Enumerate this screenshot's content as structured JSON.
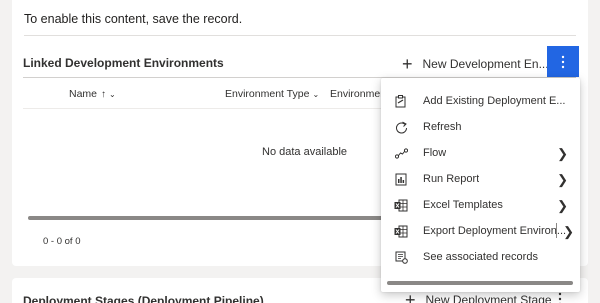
{
  "notice": {
    "text": "To enable this content, save the record."
  },
  "linked_subgrid": {
    "title": "Linked Development Environments",
    "new_button_label": "New Development En...",
    "more_commands_icon": "more-vertical-icon",
    "columns": [
      {
        "label": "Name",
        "sort": "ascending"
      },
      {
        "label": "Environment Type"
      },
      {
        "label": "Environment"
      }
    ],
    "empty_message": "No data available",
    "paging": "0 - 0 of 0"
  },
  "stages_subgrid": {
    "title": "Deployment Stages (Deployment Pipeline)",
    "new_button_label": "New Deployment Stage"
  },
  "overflow_menu": {
    "items": [
      {
        "label": "Add Existing Deployment E...",
        "icon": "add-existing-icon",
        "has_submenu": false
      },
      {
        "label": "Refresh",
        "icon": "refresh-icon",
        "has_submenu": false
      },
      {
        "label": "Flow",
        "icon": "flow-icon",
        "has_submenu": true
      },
      {
        "label": "Run Report",
        "icon": "report-icon",
        "has_submenu": true
      },
      {
        "label": "Excel Templates",
        "icon": "excel-icon",
        "has_submenu": true
      },
      {
        "label": "Export Deployment Environ...",
        "icon": "excel-export-icon",
        "has_submenu": true,
        "split": true
      },
      {
        "label": "See associated records",
        "icon": "associated-records-icon",
        "has_submenu": false
      }
    ]
  },
  "colors": {
    "accent": "#2266e3",
    "background": "#f3f2f1",
    "card": "#ffffff"
  }
}
